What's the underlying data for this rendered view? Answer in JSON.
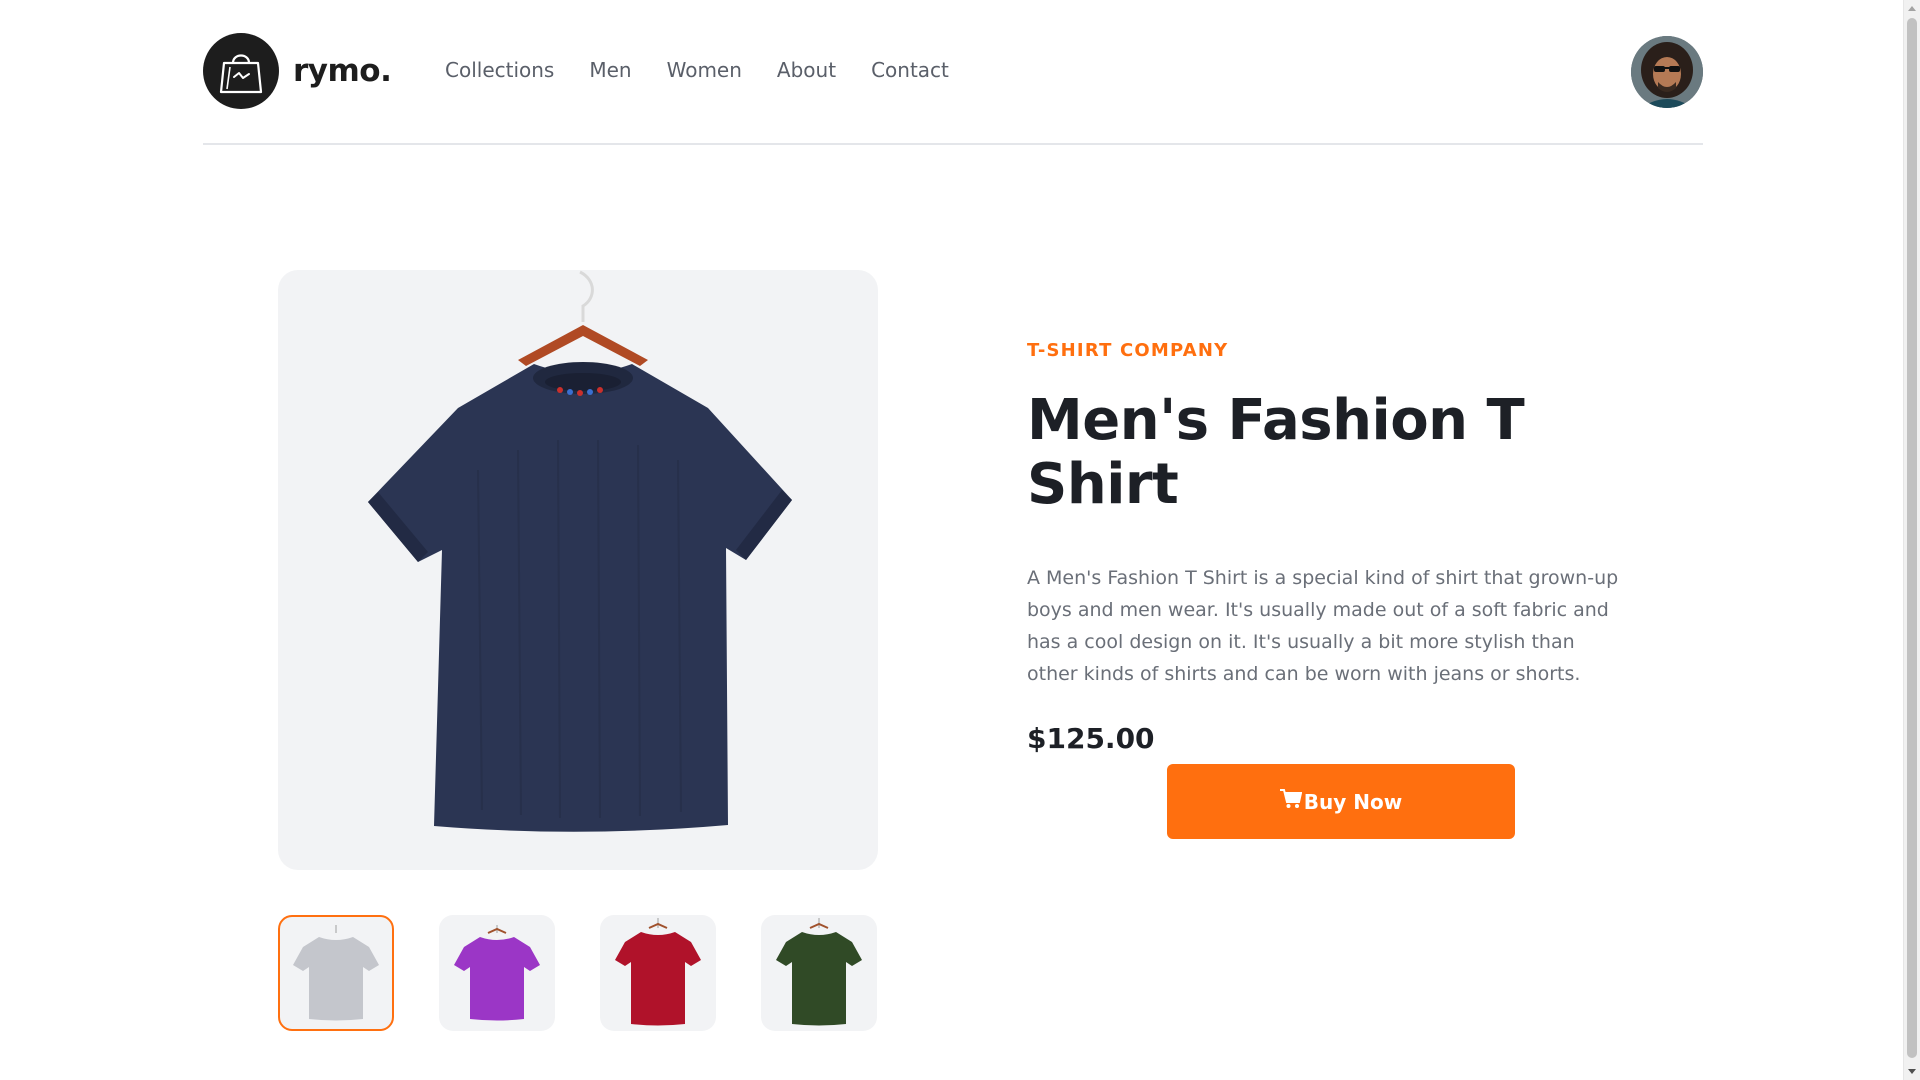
{
  "brand": {
    "name": "rymo."
  },
  "nav": {
    "items": [
      {
        "label": "Collections"
      },
      {
        "label": "Men"
      },
      {
        "label": "Women"
      },
      {
        "label": "About"
      },
      {
        "label": "Contact"
      }
    ]
  },
  "product": {
    "company": "T-SHIRT COMPANY",
    "title": "Men's Fashion T Shirt",
    "description": "A Men's Fashion T Shirt is a special kind of shirt that grown-up boys and men wear. It's usually made out of a soft fabric and has a cool design on it. It's usually a bit more stylish than other kinds of shirts and can be worn with jeans or shorts.",
    "price": "$125.00",
    "buy_label": "Buy Now",
    "buy_icon": "cart-icon",
    "main_color": "#2b3553",
    "thumbnails": [
      {
        "color": "#c4c6cc",
        "selected": true
      },
      {
        "color": "#9b36c6",
        "selected": false
      },
      {
        "color": "#b0122a",
        "selected": false
      },
      {
        "color": "#304a26",
        "selected": false
      }
    ]
  },
  "colors": {
    "accent": "#ff6f0f",
    "text_dark": "#1d2026",
    "text_muted": "#6a6f78",
    "panel_bg": "#f2f3f5"
  }
}
